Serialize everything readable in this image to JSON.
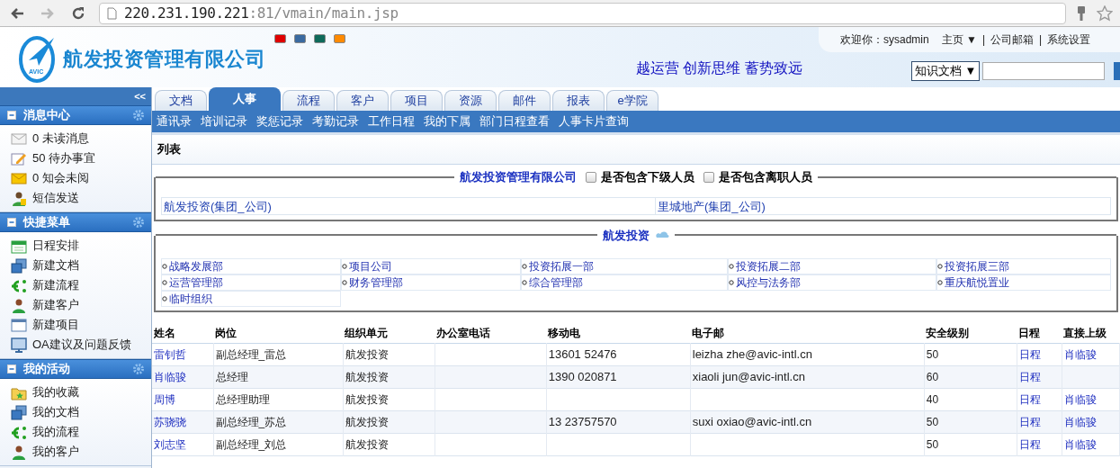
{
  "browser": {
    "url_host": "220.231.190.221",
    "url_path": ":81/vmain/main.jsp"
  },
  "header": {
    "company": "航发投资管理有限公司",
    "logo_mark": "AVIC",
    "theme_colors": [
      {
        "color": "#e00000",
        "selected": false
      },
      {
        "color": "#3a6aa0",
        "selected": false
      },
      {
        "color": "#0e6a5a",
        "selected": false
      },
      {
        "color": "#ff8a00",
        "selected": false
      }
    ],
    "slogan": "越运营 创新思维 蓄势致远",
    "welcome": "欢迎你：sysadmin",
    "top_links": [
      "主页 ▼",
      "|",
      "公司邮箱",
      "|",
      "系统设置"
    ],
    "search_scope": "知识文档 ▼"
  },
  "sidebar": {
    "collapse": "<<",
    "sections": [
      {
        "title": "消息中心",
        "items": [
          "0 未读消息",
          "50 待办事宜",
          "0 知会未阅",
          "短信发送"
        ]
      },
      {
        "title": "快捷菜单",
        "items": [
          "日程安排",
          "新建文档",
          "新建流程",
          "新建客户",
          "新建项目",
          "OA建议及问题反馈"
        ]
      },
      {
        "title": "我的活动",
        "items": [
          "我的收藏",
          "我的文档",
          "我的流程",
          "我的客户"
        ]
      }
    ]
  },
  "tabs": [
    {
      "label": "文档",
      "selected": false
    },
    {
      "label": "人事",
      "selected": true
    },
    {
      "label": "流程",
      "selected": false
    },
    {
      "label": "客户",
      "selected": false
    },
    {
      "label": "项目",
      "selected": false
    },
    {
      "label": "资源",
      "selected": false
    },
    {
      "label": "邮件",
      "selected": false
    },
    {
      "label": "报表",
      "selected": false
    },
    {
      "label": "e学院",
      "selected": false
    }
  ],
  "subnav": [
    "通讯录",
    "培训记录",
    "奖惩记录",
    "考勤记录",
    "工作日程",
    "我的下属",
    "部门日程查看",
    "人事卡片查询"
  ],
  "panel_title": "列表",
  "org": {
    "legend": "航发投资管理有限公司",
    "options": [
      {
        "label": "是否包含下级人员",
        "checked": false
      },
      {
        "label": "是否包含离职人员",
        "checked": false
      }
    ],
    "units": [
      "航发投资(集团_公司)",
      "里城地产(集团_公司)"
    ]
  },
  "dept": {
    "legend": "航发投资",
    "items": [
      "战略发展部",
      "项目公司",
      "投资拓展一部",
      "投资拓展二部",
      "投资拓展三部",
      "运营管理部",
      "财务管理部",
      "综合管理部",
      "风控与法务部",
      "重庆航悦置业",
      "临时组织"
    ]
  },
  "table": {
    "columns": [
      "姓名",
      "岗位",
      "组织单元",
      "办公室电话",
      "移动电",
      "电子邮",
      "安全级别",
      "日程",
      "直接上级"
    ],
    "rows": [
      {
        "name": "雷钊哲",
        "post": "副总经理_雷总",
        "unit": "航发投资",
        "mobile": "13601 52476",
        "email": "leizha zhe@avic-intl.cn",
        "level": "50",
        "schedule": "日程",
        "manager": "肖临骏"
      },
      {
        "name": "肖临骏",
        "post": "总经理",
        "unit": "航发投资",
        "mobile": "1390 020871",
        "email": "xiaoli jun@avic-intl.cn",
        "level": "60",
        "schedule": "日程"
      },
      {
        "name": "周博",
        "post": "总经理助理",
        "unit": "航发投资",
        "level": "40",
        "schedule": "日程",
        "manager": "肖临骏"
      },
      {
        "name": "苏骁骁",
        "post": "副总经理_苏总",
        "unit": "航发投资",
        "mobile": "13 23757570",
        "email": "suxi oxiao@avic-intl.cn",
        "level": "50",
        "schedule": "日程",
        "manager": "肖临骏"
      },
      {
        "name": "刘志坚",
        "post": "副总经理_刘总",
        "unit": "航发投资",
        "level": "50",
        "schedule": "日程",
        "manager": "肖临骏"
      }
    ]
  }
}
